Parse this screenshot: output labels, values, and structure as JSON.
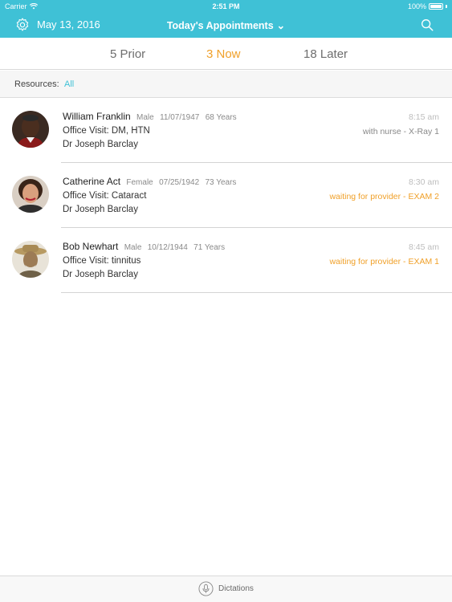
{
  "status_bar": {
    "carrier": "Carrier",
    "time": "2:51 PM",
    "battery": "100%"
  },
  "nav": {
    "date": "May 13, 2016",
    "title": "Today's Appointments",
    "title_chevron": "⌄",
    "left_icon": "gear-icon",
    "right_icon": "search-icon"
  },
  "tabs": {
    "prior": "5 Prior",
    "now": "3 Now",
    "later": "18 Later"
  },
  "resources": {
    "label": "Resources:",
    "value": "All"
  },
  "appointments": [
    {
      "name": "William Franklin",
      "gender": "Male",
      "dob": "11/07/1947",
      "age": "68 Years",
      "visit": "Office Visit: DM, HTN",
      "doctor": "Dr Joseph Barclay",
      "time": "8:15 am",
      "status": "with nurse - X-Ray 1"
    },
    {
      "name": "Catherine Act",
      "gender": "Female",
      "dob": "07/25/1942",
      "age": "73 Years",
      "visit": "Office Visit: Cataract",
      "doctor": "Dr Joseph Barclay",
      "time": "8:30 am",
      "status": "waiting for provider - EXAM 2"
    },
    {
      "name": "Bob Newhart",
      "gender": "Male",
      "dob": "10/12/1944",
      "age": "71 Years",
      "visit": "Office Visit: tinnitus",
      "doctor": "Dr Joseph Barclay",
      "time": "8:45 am",
      "status": "waiting for provider - EXAM 1"
    }
  ],
  "footer": {
    "dictations": "Dictations",
    "icon": "microphone-icon"
  },
  "colors": {
    "accent": "#3fc1d6",
    "active_tab": "#f0a029",
    "waiting": "#f0a029"
  }
}
